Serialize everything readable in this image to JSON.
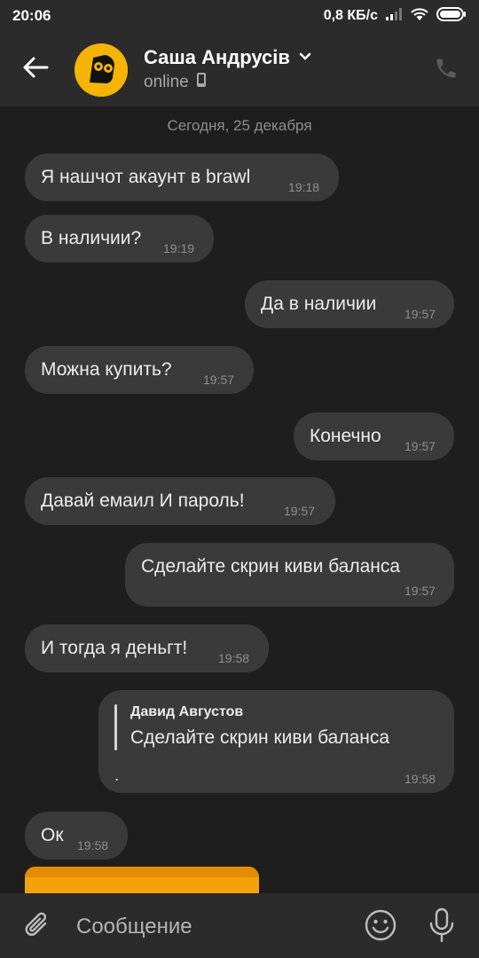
{
  "status_bar": {
    "time": "20:06",
    "net_speed": "0,8 КБ/с",
    "icons": [
      "signal-icon",
      "wifi-icon",
      "battery-icon"
    ]
  },
  "header": {
    "contact_name": "Саша Андрусів",
    "status": "online",
    "icons": [
      "back-arrow-icon",
      "chevron-down-icon",
      "mobile-device-icon",
      "phone-icon"
    ]
  },
  "chat": {
    "date_separator": "Сегодня, 25 декабря",
    "messages": [
      {
        "direction": "in",
        "text": "Я нашчот акаунт в brawl",
        "time": "19:18"
      },
      {
        "direction": "in",
        "text": "В наличии?",
        "time": "19:19"
      },
      {
        "direction": "out",
        "text": "Да в наличии",
        "time": "19:57"
      },
      {
        "direction": "in",
        "text": "Можна купить?",
        "time": "19:57"
      },
      {
        "direction": "out",
        "text": "Конечно",
        "time": "19:57"
      },
      {
        "direction": "in",
        "text": "Давай емаил И пароль!",
        "time": "19:57"
      },
      {
        "direction": "out",
        "text": "Сделайте скрин киви баланса",
        "time": "19:57"
      },
      {
        "direction": "in",
        "text": "И тогда я деньгт!",
        "time": "19:58"
      },
      {
        "direction": "out",
        "text": ".",
        "time": "19:58",
        "reply": {
          "author": "Давид Августов",
          "text": "Сделайте скрин киви баланса"
        }
      },
      {
        "direction": "in",
        "text": "Ок",
        "time": "19:58"
      }
    ]
  },
  "input_bar": {
    "placeholder": "Сообщение",
    "icons": [
      "attachment-icon",
      "emoji-icon",
      "microphone-icon"
    ]
  },
  "colors": {
    "background": "#1e1e1e",
    "bar": "#2b2b2b",
    "bubble": "#3a3a3a",
    "avatar": "#f5b400"
  }
}
